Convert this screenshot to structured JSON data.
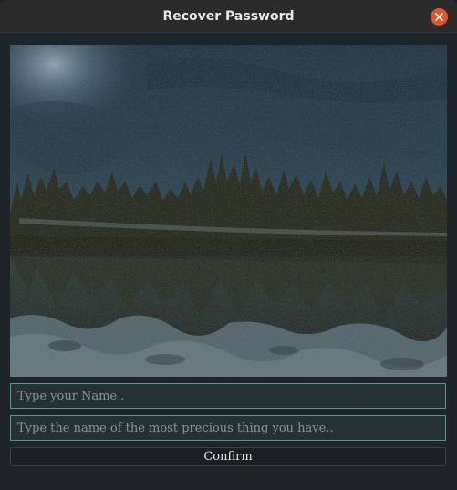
{
  "window": {
    "title": "Recover Password"
  },
  "form": {
    "name_placeholder": "Type your Name..",
    "secret_placeholder": "Type the name of the most precious thing you have..",
    "confirm_label": "Confirm"
  },
  "colors": {
    "close_button": "#e5532a",
    "field_border": "#4f9c86",
    "background": "#1e2428"
  },
  "icons": {
    "close": "close-icon"
  }
}
